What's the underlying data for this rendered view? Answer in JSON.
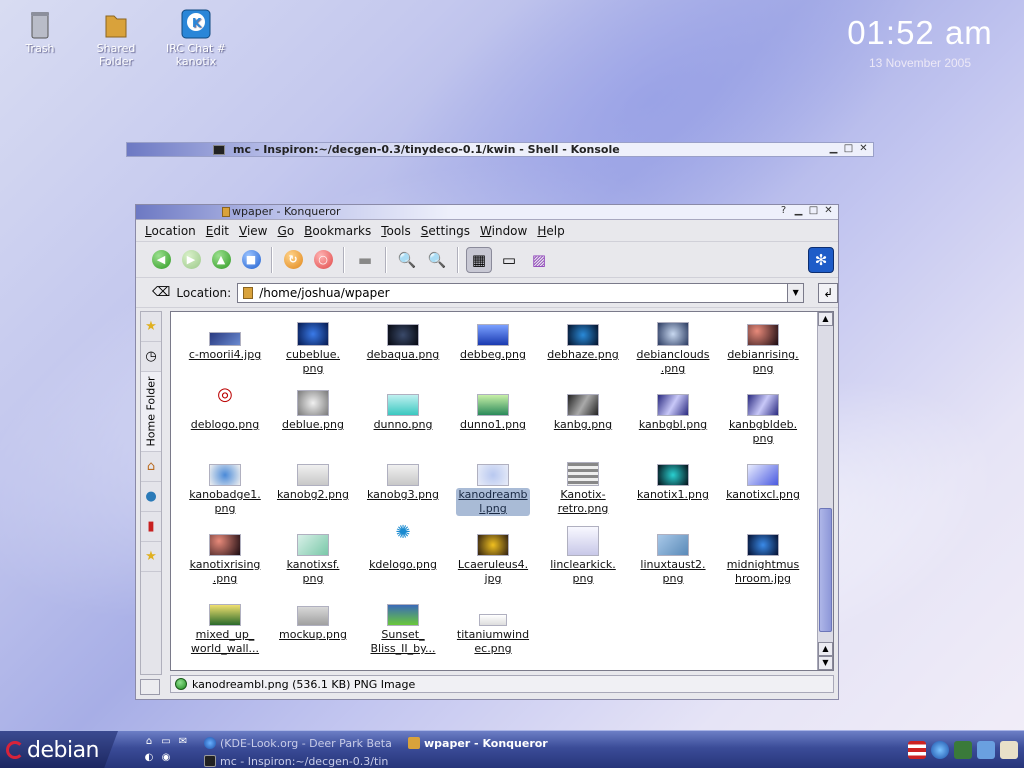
{
  "desktop": {
    "icons": [
      {
        "label": "Trash"
      },
      {
        "label": "Shared\nFolder"
      },
      {
        "label": "IRC Chat #\nkanotix"
      }
    ],
    "clock": {
      "time": "01:52 am",
      "date": "13 November 2005"
    }
  },
  "konsole": {
    "title": "mc - Inspiron:~/decgen-0.3/tinydeco-0.1/kwin - Shell - Konsole"
  },
  "konqueror": {
    "title": "wpaper - Konqueror",
    "menu": [
      "Location",
      "Edit",
      "View",
      "Go",
      "Bookmarks",
      "Tools",
      "Settings",
      "Window",
      "Help"
    ],
    "location_label": "Location:",
    "location_value": "/home/joshua/wpaper",
    "sidebar_label": "Home Folder",
    "files": [
      {
        "name": "c-moorii4.jpg",
        "icon": "image-thumb"
      },
      {
        "name": "cubeblue.\npng",
        "icon": "image-thumb"
      },
      {
        "name": "debaqua.png",
        "icon": "image-thumb"
      },
      {
        "name": "debbeg.png",
        "icon": "image-thumb"
      },
      {
        "name": "debhaze.png",
        "icon": "image-thumb"
      },
      {
        "name": "debianclouds\n.png",
        "icon": "image-thumb"
      },
      {
        "name": "debianrising.\npng",
        "icon": "image-thumb"
      },
      {
        "name": "deblogo.png",
        "icon": "image-thumb"
      },
      {
        "name": "deblue.png",
        "icon": "image-thumb"
      },
      {
        "name": "dunno.png",
        "icon": "image-thumb"
      },
      {
        "name": "dunno1.png",
        "icon": "image-thumb"
      },
      {
        "name": "kanbg.png",
        "icon": "image-thumb"
      },
      {
        "name": "kanbgbl.png",
        "icon": "image-thumb"
      },
      {
        "name": "kanbgbldeb.\npng",
        "icon": "image-thumb"
      },
      {
        "name": "kanobadge1.\npng",
        "icon": "image-thumb"
      },
      {
        "name": "kanobg2.png",
        "icon": "image-thumb"
      },
      {
        "name": "kanobg3.png",
        "icon": "image-thumb"
      },
      {
        "name": "kanodreamb\nl.png",
        "icon": "image-thumb"
      },
      {
        "name": "Kanotix-\nretro.png",
        "icon": "image-thumb"
      },
      {
        "name": "kanotix1.png",
        "icon": "image-thumb"
      },
      {
        "name": "kanotixcl.png",
        "icon": "image-thumb"
      },
      {
        "name": "kanotixrising\n.png",
        "icon": "image-thumb"
      },
      {
        "name": "kanotixsf.\npng",
        "icon": "image-thumb"
      },
      {
        "name": "kdelogo.png",
        "icon": "image-thumb"
      },
      {
        "name": "Lcaeruleus4.\njpg",
        "icon": "image-thumb"
      },
      {
        "name": "linclearkick.\npng",
        "icon": "image-thumb"
      },
      {
        "name": "linuxtaust2.\npng",
        "icon": "image-thumb"
      },
      {
        "name": "midnightmus\nhroom.jpg",
        "icon": "image-thumb"
      },
      {
        "name": "mixed_up_\nworld_wall...",
        "icon": "image-thumb"
      },
      {
        "name": "mockup.png",
        "icon": "image-thumb"
      },
      {
        "name": "Sunset_\nBliss_II_by...",
        "icon": "image-thumb"
      },
      {
        "name": "titaniumwind\nec.png",
        "icon": "image-thumb"
      }
    ],
    "selected": "kanodreamb\nl.png",
    "status": "kanodreambl.png (536.1 KB)  PNG Image"
  },
  "taskbar": {
    "start_label": "debian",
    "tasks": [
      {
        "label": "(KDE-Look.org - Deer Park Beta",
        "active": false
      },
      {
        "label": "wpaper - Konqueror",
        "active": true
      },
      {
        "label": "mc - Inspiron:~/decgen-0.3/tin",
        "active": false
      }
    ]
  },
  "colors": {
    "accent": "#6d79c3",
    "selection": "#a9bbd6",
    "taskbar": "#3b4c98"
  }
}
